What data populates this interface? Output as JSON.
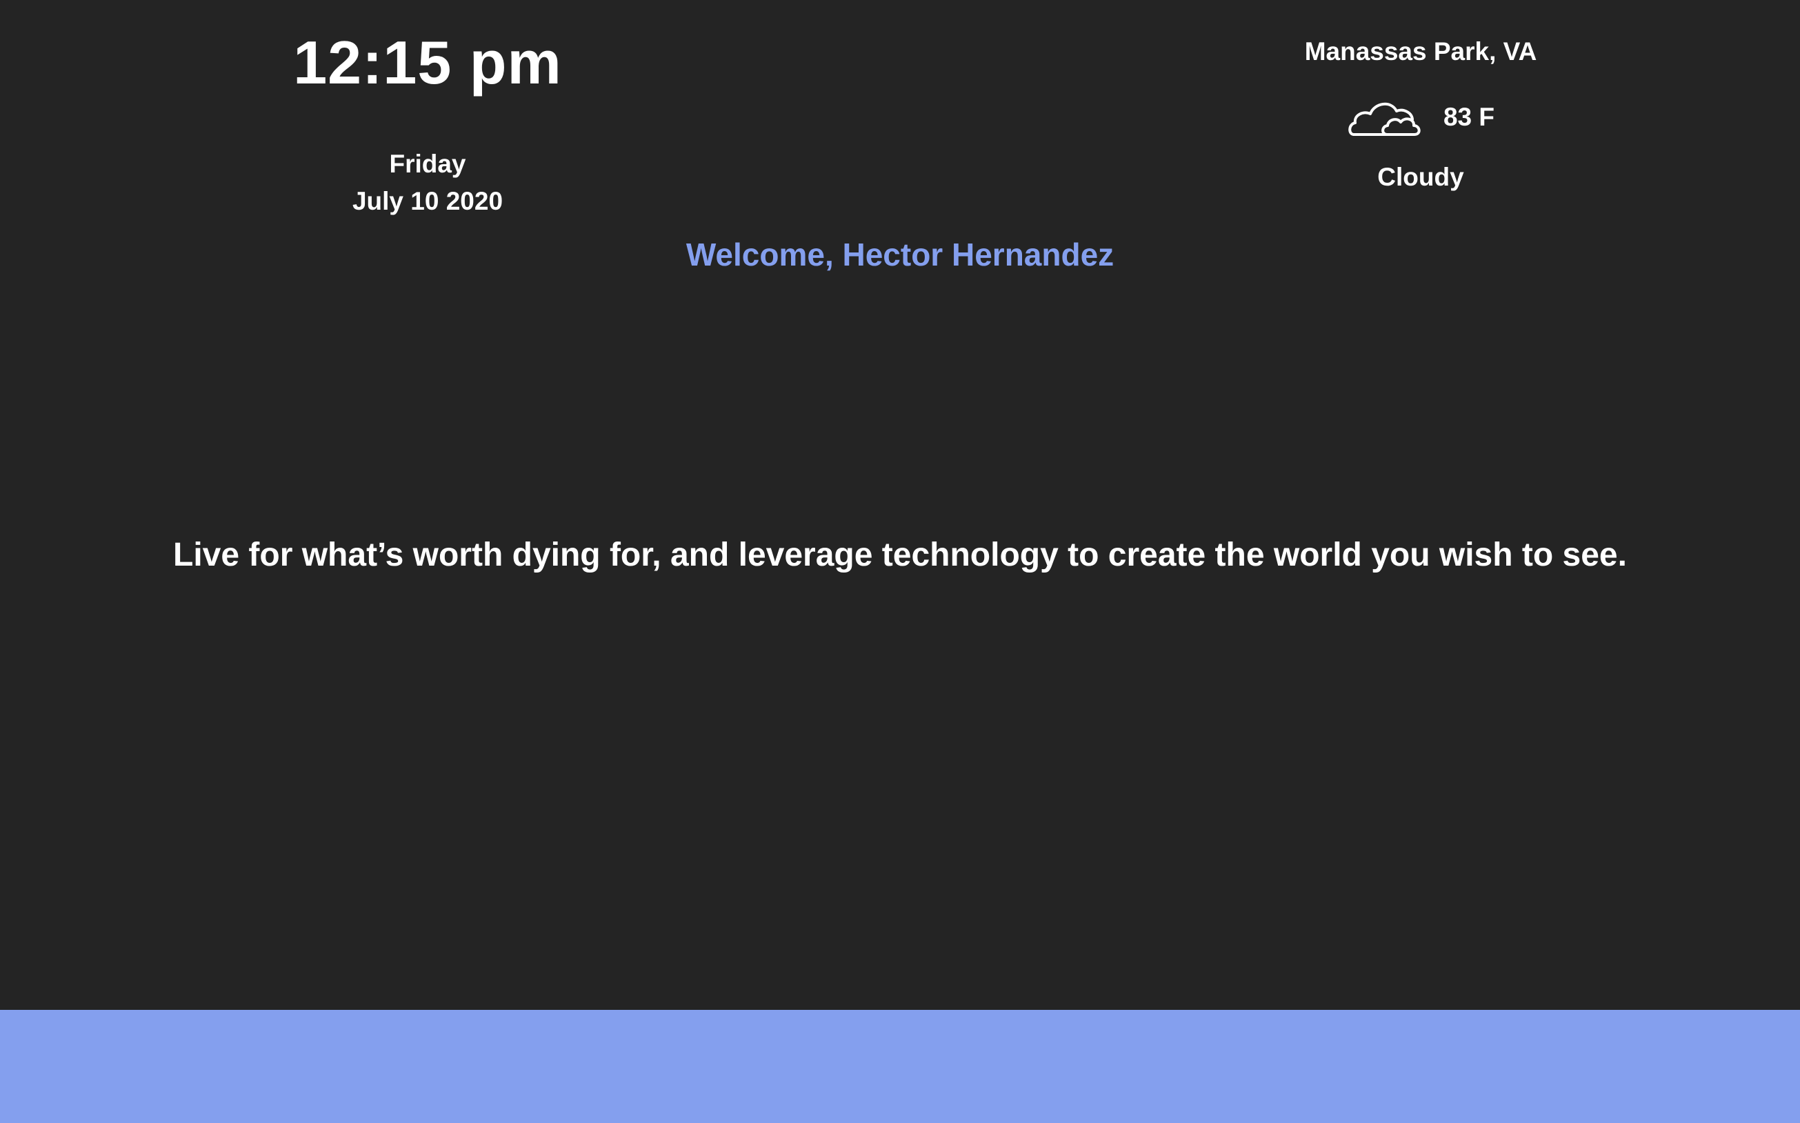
{
  "clock": {
    "time": "12:15 pm",
    "day": "Friday",
    "date": "July 10 2020"
  },
  "weather": {
    "location": "Manassas Park, VA",
    "icon": "cloud-icon",
    "temperature": "83 F",
    "condition": "Cloudy"
  },
  "welcome": {
    "text": "Welcome, Hector Hernandez"
  },
  "quote": {
    "text": "Live for what’s worth dying for, and leverage technology to create the world you wish to see."
  },
  "colors": {
    "background": "#242424",
    "accent": "#849fee",
    "text": "#ffffff"
  }
}
